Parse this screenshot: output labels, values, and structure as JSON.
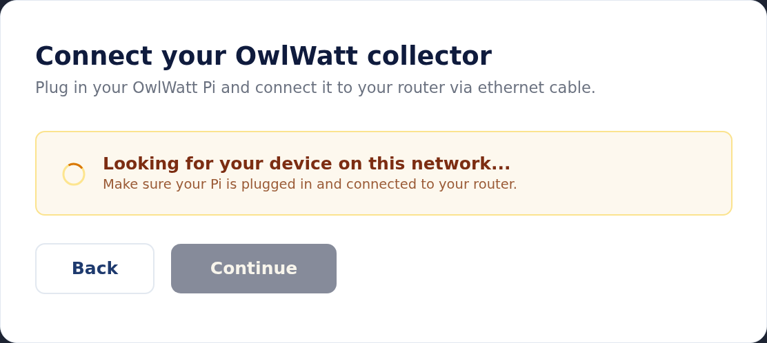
{
  "dialog": {
    "title": "Connect your OwlWatt collector",
    "subtitle": "Plug in your OwlWatt Pi and connect it to your router via ethernet cable."
  },
  "status": {
    "title": "Looking for your device on this network...",
    "message": "Make sure your Pi is plugged in and connected to your router."
  },
  "buttons": [
    {
      "label": "Back",
      "kind": "secondary",
      "disabled": false
    },
    {
      "label": "Continue",
      "kind": "primary",
      "disabled": true
    }
  ]
}
